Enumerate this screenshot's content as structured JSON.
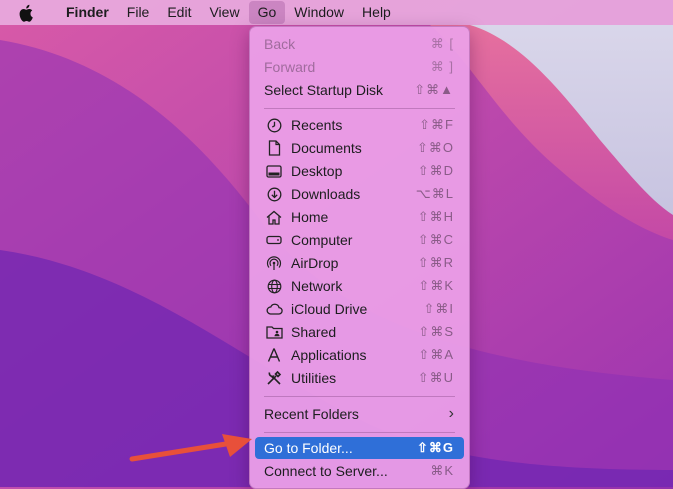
{
  "menubar": {
    "items": [
      "Finder",
      "File",
      "Edit",
      "View",
      "Go",
      "Window",
      "Help"
    ]
  },
  "menu": {
    "back": {
      "label": "Back",
      "shortcut": "⌘ ["
    },
    "forward": {
      "label": "Forward",
      "shortcut": "⌘ ]"
    },
    "startup": {
      "label": "Select Startup Disk",
      "shortcut": "⇧⌘▲"
    },
    "recents": {
      "label": "Recents",
      "shortcut": "⇧⌘F",
      "icon": "clock-icon"
    },
    "documents": {
      "label": "Documents",
      "shortcut": "⇧⌘O",
      "icon": "document-icon"
    },
    "desktop": {
      "label": "Desktop",
      "shortcut": "⇧⌘D",
      "icon": "desktop-icon"
    },
    "downloads": {
      "label": "Downloads",
      "shortcut": "⌥⌘L",
      "icon": "download-icon"
    },
    "home": {
      "label": "Home",
      "shortcut": "⇧⌘H",
      "icon": "home-icon"
    },
    "computer": {
      "label": "Computer",
      "shortcut": "⇧⌘C",
      "icon": "computer-icon"
    },
    "airdrop": {
      "label": "AirDrop",
      "shortcut": "⇧⌘R",
      "icon": "airdrop-icon"
    },
    "network": {
      "label": "Network",
      "shortcut": "⇧⌘K",
      "icon": "network-icon"
    },
    "icloud": {
      "label": "iCloud Drive",
      "shortcut": "⇧⌘I",
      "icon": "cloud-icon"
    },
    "shared": {
      "label": "Shared",
      "shortcut": "⇧⌘S",
      "icon": "shared-folder-icon"
    },
    "applications": {
      "label": "Applications",
      "shortcut": "⇧⌘A",
      "icon": "applications-icon"
    },
    "utilities": {
      "label": "Utilities",
      "shortcut": "⇧⌘U",
      "icon": "utilities-icon"
    },
    "recent_folders": {
      "label": "Recent Folders"
    },
    "go_to_folder": {
      "label": "Go to Folder...",
      "shortcut": "⇧⌘G"
    },
    "connect": {
      "label": "Connect to Server...",
      "shortcut": "⌘K"
    }
  },
  "colors": {
    "highlight": "#2f6fd8",
    "arrow": "#e8503a"
  }
}
